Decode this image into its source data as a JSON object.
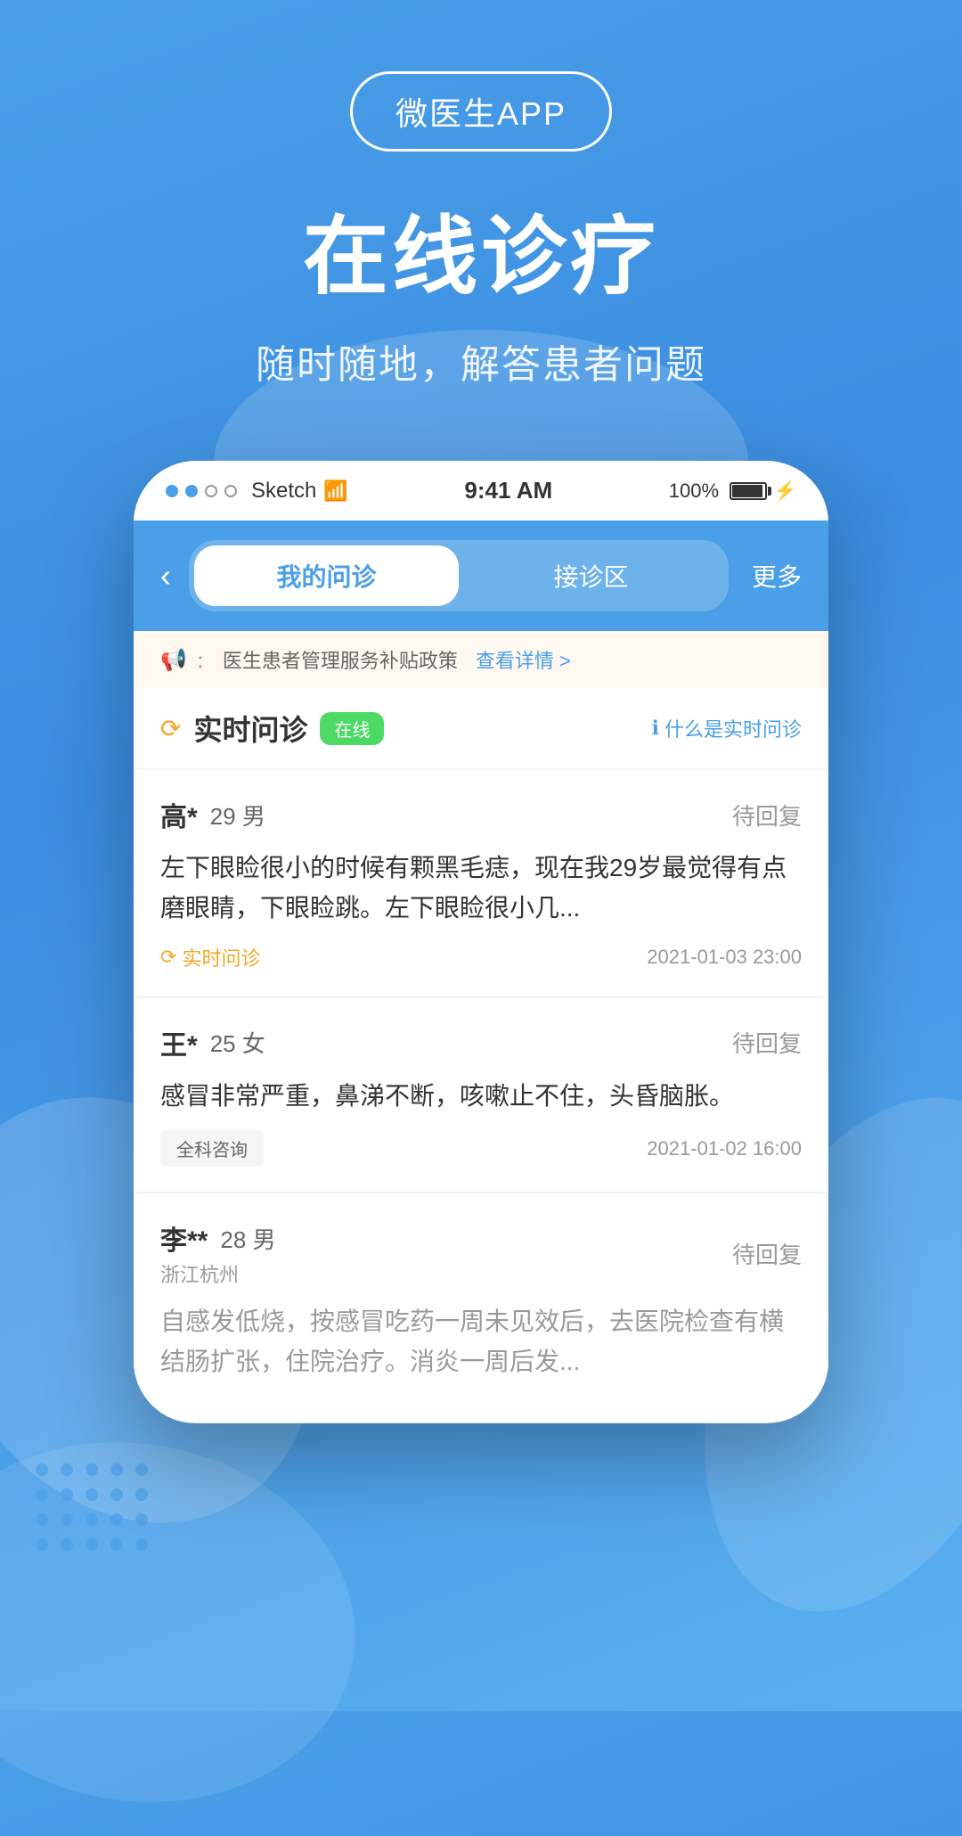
{
  "app": {
    "badge_text": "微医生APP",
    "main_title": "在线诊疗",
    "subtitle": "随时随地，解答患者问题"
  },
  "status_bar": {
    "carrier": "Sketch",
    "time": "9:41 AM",
    "battery": "100%"
  },
  "nav": {
    "back_icon": "‹",
    "tab1": "我的问诊",
    "tab2": "接诊区",
    "more": "更多"
  },
  "notice": {
    "text": "医生患者管理服务补贴政策",
    "link": "查看详情 >"
  },
  "realtime_section": {
    "icon": "⟳",
    "title": "实时问诊",
    "online_badge": "在线",
    "help_icon": "?",
    "help_text": "什么是实时问诊"
  },
  "patients": [
    {
      "name": "高*",
      "age": "29",
      "gender": "男",
      "status": "待回复",
      "message": "左下眼睑很小的时候有颗黑毛痣，现在我29岁最觉得有点磨眼睛，下眼睑跳。左下眼睑很小几...",
      "consult_type": "实时问诊",
      "consult_type_icon": "⟳",
      "time": "2021-01-03 23:00",
      "location": ""
    },
    {
      "name": "王*",
      "age": "25",
      "gender": "女",
      "status": "待回复",
      "message": "感冒非常严重，鼻涕不断，咳嗽止不住，头昏脑胀。",
      "consult_type": "全科咨询",
      "consult_type_icon": "",
      "time": "2021-01-02 16:00",
      "location": ""
    },
    {
      "name": "李**",
      "age": "28",
      "gender": "男",
      "status": "待回复",
      "message": "自感发低烧，按感冒吃药一周未见效后，去医院检查有横结肠扩张，住院治疗。消炎一周后发...",
      "consult_type": "",
      "consult_type_icon": "",
      "time": "",
      "location": "浙江杭州"
    }
  ]
}
